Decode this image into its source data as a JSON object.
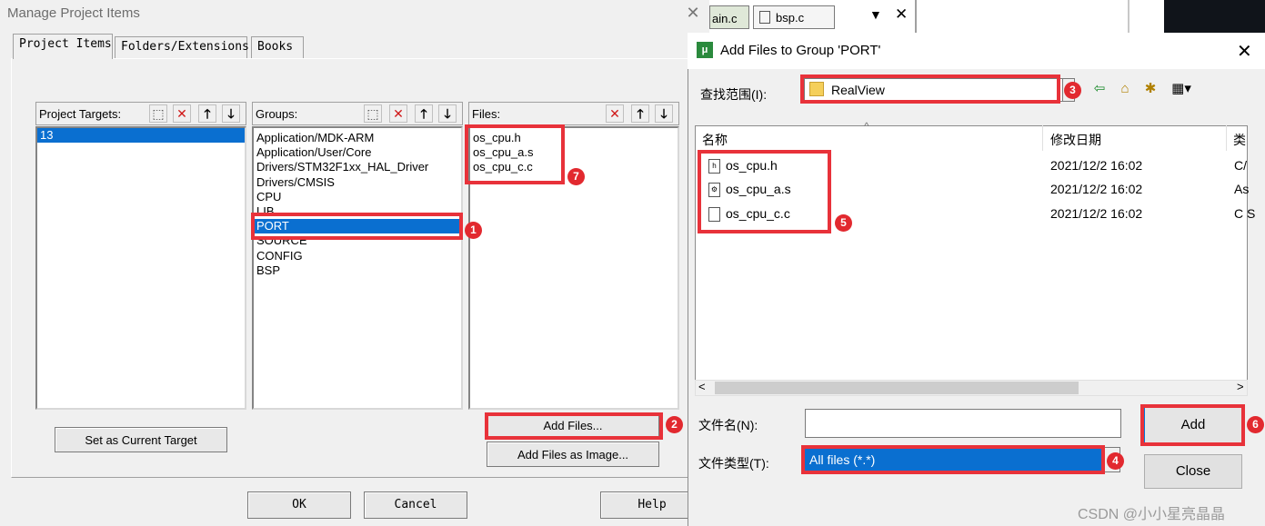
{
  "manage": {
    "title": "Manage Project Items",
    "close_glyph": "✕",
    "tabs": [
      {
        "label": "Project Items"
      },
      {
        "label": "Folders/Extensions"
      },
      {
        "label": "Books"
      }
    ],
    "targets": {
      "header": "Project Targets:",
      "items": [
        "13"
      ],
      "selected": 0
    },
    "groups": {
      "header": "Groups:",
      "items": [
        "Application/MDK-ARM",
        "Application/User/Core",
        "Drivers/STM32F1xx_HAL_Driver",
        "Drivers/CMSIS",
        "CPU",
        "LIB",
        "PORT",
        "SOURCE",
        "CONFIG",
        "BSP"
      ],
      "selected": 6
    },
    "files": {
      "header": "Files:",
      "items": [
        "os_cpu.h",
        "os_cpu_a.s",
        "os_cpu_c.c"
      ]
    },
    "buttons": {
      "set_current_target": "Set as Current Target",
      "add_files": "Add Files...",
      "add_files_image": "Add Files as Image...",
      "ok": "OK",
      "cancel": "Cancel",
      "help": "Help"
    },
    "toolbar_glyphs": {
      "new": "⬚",
      "delete": "✕",
      "up": "🡑",
      "down": "🡓"
    }
  },
  "editor": {
    "tabs": [
      {
        "label": "ain.c"
      },
      {
        "label": "bsp.c"
      }
    ],
    "dropdown_glyph": "▼",
    "close_glyph": "✕"
  },
  "add_files": {
    "title": "Add Files to Group 'PORT'",
    "close_glyph": "✕",
    "look_in_label": "查找范围(I):",
    "look_in_value": "RealView",
    "columns": {
      "name": "名称",
      "date": "修改日期",
      "type": "类"
    },
    "files": [
      {
        "name": "os_cpu.h",
        "date": "2021/12/2 16:02",
        "type": "C/"
      },
      {
        "name": "os_cpu_a.s",
        "date": "2021/12/2 16:02",
        "type": "As"
      },
      {
        "name": "os_cpu_c.c",
        "date": "2021/12/2 16:02",
        "type": "C S"
      }
    ],
    "filename_label": "文件名(N):",
    "filename_value": "",
    "filetype_label": "文件类型(T):",
    "filetype_value": "All files (*.*)",
    "add_label": "Add",
    "close_label": "Close",
    "scroll_left": "<",
    "scroll_right": ">",
    "sort_glyph": "^"
  },
  "annotations": [
    "1",
    "2",
    "3",
    "4",
    "5",
    "6",
    "7"
  ],
  "watermark": "CSDN @小小星亮晶晶",
  "colors": {
    "highlight": "#e8323a",
    "selection": "#0a6fd0"
  }
}
